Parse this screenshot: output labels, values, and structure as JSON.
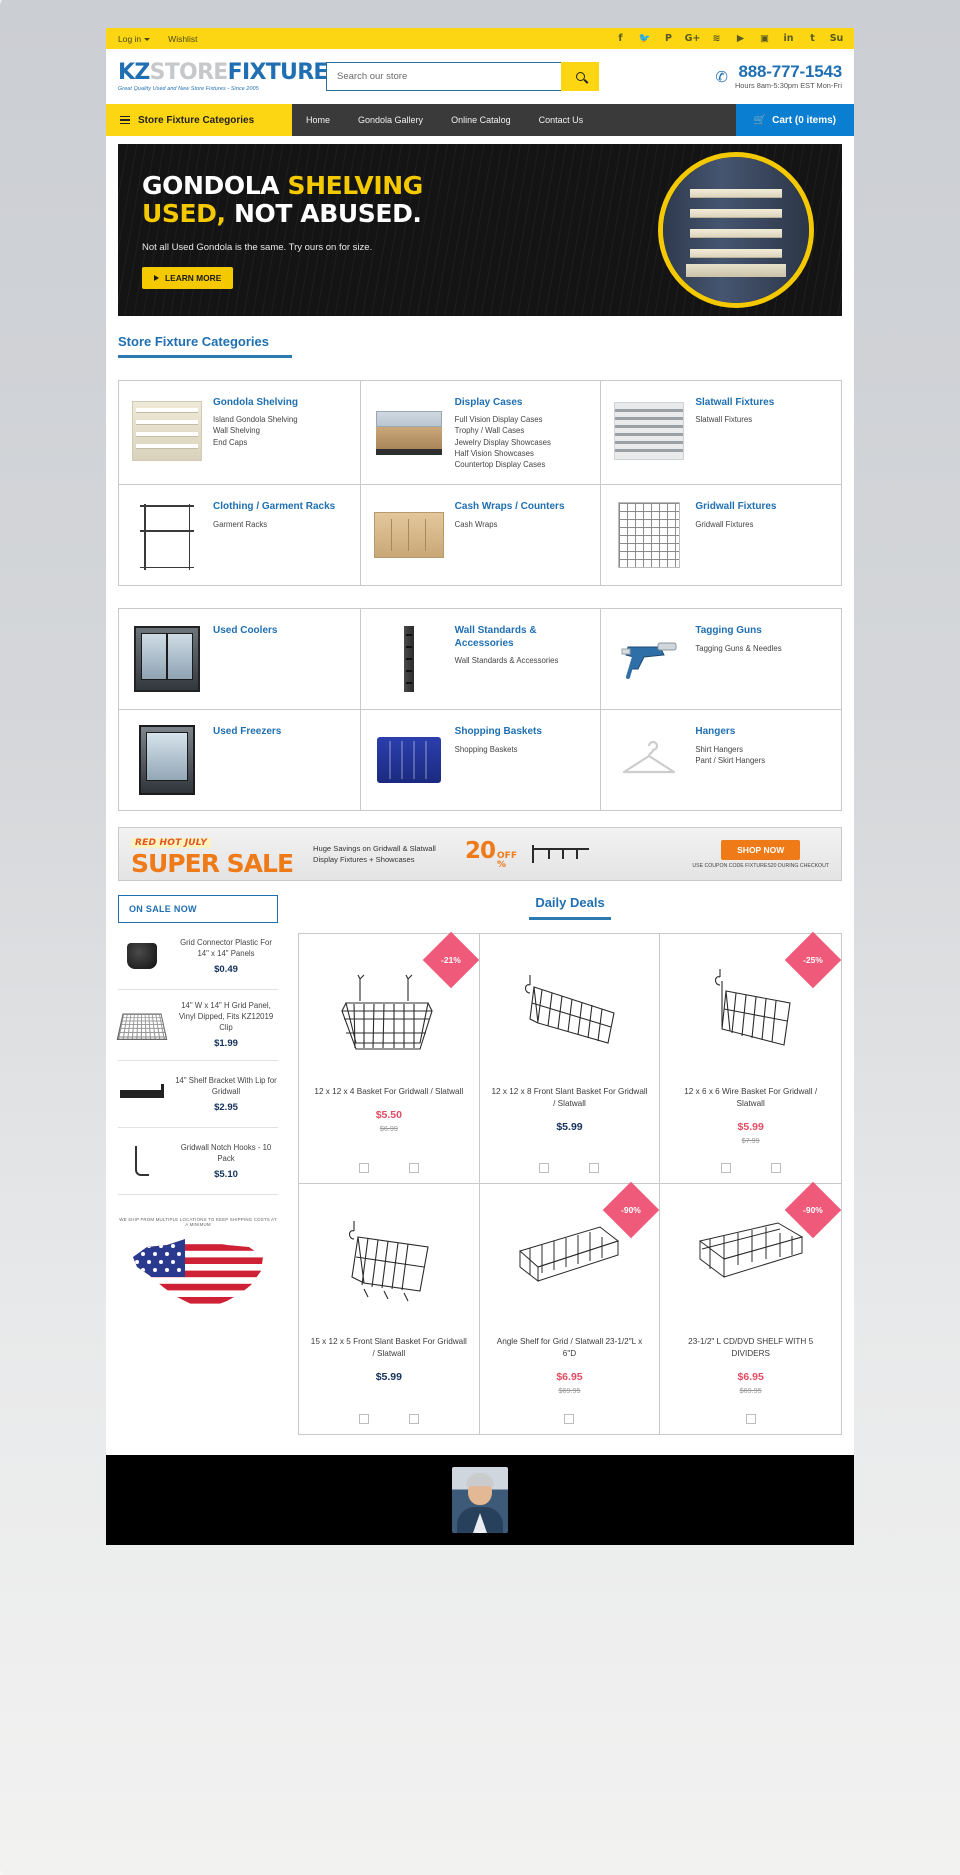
{
  "topbar": {
    "login": "Log in",
    "wishlist": "Wishlist",
    "social": [
      {
        "name": "facebook-icon",
        "glyph": "f"
      },
      {
        "name": "twitter-icon",
        "glyph": "ᵥ"
      },
      {
        "name": "pinterest-icon",
        "glyph": "P"
      },
      {
        "name": "googleplus-icon",
        "glyph": "G+"
      },
      {
        "name": "rss-icon",
        "glyph": "ʀ"
      },
      {
        "name": "youtube-icon",
        "glyph": "▶"
      },
      {
        "name": "instagram-icon",
        "glyph": "▣"
      },
      {
        "name": "linkedin-icon",
        "glyph": "in"
      },
      {
        "name": "tumblr-icon",
        "glyph": "t"
      },
      {
        "name": "stumbleupon-icon",
        "glyph": "Su"
      }
    ]
  },
  "header": {
    "logo_kz": "KZ",
    "logo_store": "STORE",
    "logo_fixtures": "FIXTURES",
    "logo_tagline": "Great Quality Used and New Store Fixtures - Since 2005",
    "search_placeholder": "Search our store",
    "search_value": "",
    "phone": "888-777-1543",
    "hours": "Hours 8am-5:30pm EST Mon-Fri"
  },
  "nav": {
    "categories_label": "Store Fixture Categories",
    "links": [
      "Home",
      "Gondola Gallery",
      "Online Catalog",
      "Contact Us"
    ],
    "cart_label": "Cart (0 items)"
  },
  "hero": {
    "line1_a": "GONDOLA ",
    "line1_b": "SHELVING",
    "line2_a": "USED,",
    "line2_b": " NOT ABUSED.",
    "subtitle": "Not all Used Gondola is the same.  Try ours on for size.",
    "button": "LEARN MORE"
  },
  "sections": {
    "categories_heading": "Store Fixture Categories",
    "deals_heading": "Daily Deals",
    "on_sale_label": "ON SALE NOW"
  },
  "categories_block1": [
    {
      "title": "Gondola Shelving",
      "thumb": "gondola",
      "links": [
        "Island Gondola Shelving",
        "Wall Shelving",
        "End Caps"
      ]
    },
    {
      "title": "Display Cases",
      "thumb": "case",
      "links": [
        "Full Vision Display Cases",
        "Trophy / Wall Cases",
        "Jewelry Display Showcases",
        "Half Vision Showcases",
        "Countertop Display Cases"
      ]
    },
    {
      "title": "Slatwall Fixtures",
      "thumb": "slatwall",
      "links": [
        "Slatwall Fixtures"
      ]
    },
    {
      "title": "Clothing / Garment Racks",
      "thumb": "rack",
      "links": [
        "Garment Racks"
      ]
    },
    {
      "title": "Cash Wraps / Counters",
      "thumb": "cash",
      "links": [
        "Cash Wraps"
      ]
    },
    {
      "title": "Gridwall Fixtures",
      "thumb": "grid",
      "links": [
        "Gridwall Fixtures"
      ]
    }
  ],
  "categories_block2": [
    {
      "title": "Used Coolers",
      "thumb": "cooler",
      "links": []
    },
    {
      "title": "Wall Standards & Accessories",
      "thumb": "wallstd",
      "links": [
        "Wall Standards & Accessories"
      ]
    },
    {
      "title": "Tagging Guns",
      "thumb": "taggun",
      "links": [
        "Tagging Guns & Needles"
      ]
    },
    {
      "title": "Used Freezers",
      "thumb": "freezer",
      "links": []
    },
    {
      "title": "Shopping Baskets",
      "thumb": "shopbasket",
      "links": [
        "Shopping Baskets"
      ]
    },
    {
      "title": "Hangers",
      "thumb": "hanger",
      "links": [
        "Shirt Hangers",
        "Pant / Skirt Hangers"
      ]
    }
  ],
  "sale_strip": {
    "eyebrow": "RED HOT JULY",
    "headline": "SUPER SALE",
    "copy": "Huge Savings on Gridwall & Slatwall Display Fixtures + Showcases",
    "percent": "20",
    "off_label": "OFF",
    "percent_symbol": "%",
    "cta": "SHOP NOW",
    "code_note": "USE COUPON CODE FIXTURES20 DURING CHECKOUT"
  },
  "sidebar_products": [
    {
      "name": "Grid Connector Plastic For 14\" x 14\" Panels",
      "price": "$0.49",
      "thumb": "connector"
    },
    {
      "name": "14\" W x 14\" H Grid Panel, Vinyl Dipped, Fits KZ12019 Clip",
      "price": "$1.99",
      "thumb": "panel"
    },
    {
      "name": "14\" Shelf Bracket With Lip for Gridwall",
      "price": "$2.95",
      "thumb": "bracket"
    },
    {
      "name": "Gridwall Notch Hooks - 10 Pack",
      "price": "$5.10",
      "thumb": "hook"
    }
  ],
  "sidebar_flag_note": "WE SHIP FROM MULTIPLE LOCATIONS TO KEEP SHIPPING COSTS AT A MINIMUM",
  "deals": [
    {
      "name": "12 x 12 x 4 Basket For Gridwall / Slatwall",
      "price": "$5.50",
      "was": "$6.99",
      "badge": "-21%",
      "on_sale": true,
      "checkboxes": 2,
      "art": "basket-front"
    },
    {
      "name": "12 x 12 x 8 Front Slant Basket For Gridwall / Slatwall",
      "price": "$5.99",
      "was": "",
      "badge": "",
      "on_sale": false,
      "checkboxes": 2,
      "art": "basket-slant"
    },
    {
      "name": "12 x 6 x 6 Wire Basket For Gridwall / Slatwall",
      "price": "$5.99",
      "was": "$7.99",
      "badge": "-25%",
      "on_sale": true,
      "checkboxes": 2,
      "art": "basket-wire"
    },
    {
      "name": "15 x 12 x 5 Front Slant Basket For Gridwall / Slatwall",
      "price": "$5.99",
      "was": "",
      "badge": "",
      "on_sale": false,
      "checkboxes": 2,
      "art": "basket-front2"
    },
    {
      "name": "Angle Shelf for Grid / Slatwall 23-1/2\"L x 6\"D",
      "price": "$6.95",
      "was": "$69.95",
      "badge": "-90%",
      "on_sale": true,
      "checkboxes": 1,
      "art": "angle-shelf"
    },
    {
      "name": "23-1/2\" L CD/DVD SHELF WITH 5 DIVIDERS",
      "price": "$6.95",
      "was": "$69.95",
      "badge": "-90%",
      "on_sale": true,
      "checkboxes": 1,
      "art": "cd-shelf"
    }
  ]
}
